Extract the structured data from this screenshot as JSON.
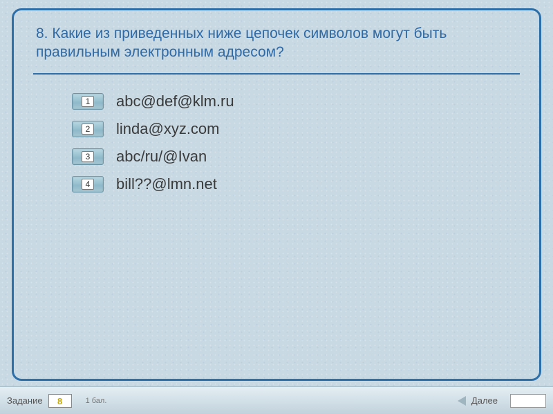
{
  "question": "8. Какие из приведенных ниже цепочек символов могут быть правильным электронным адресом?",
  "options": [
    {
      "num": "1",
      "text": "abc@def@klm.ru"
    },
    {
      "num": "2",
      "text": "linda@xyz.com"
    },
    {
      "num": "3",
      "text": "abc/ru/@Ivan"
    },
    {
      "num": "4",
      "text": "bill??@lmn.net"
    }
  ],
  "footer": {
    "task_label": "Задание",
    "task_number": "8",
    "points": "1 бал.",
    "next_label": "Далее"
  }
}
